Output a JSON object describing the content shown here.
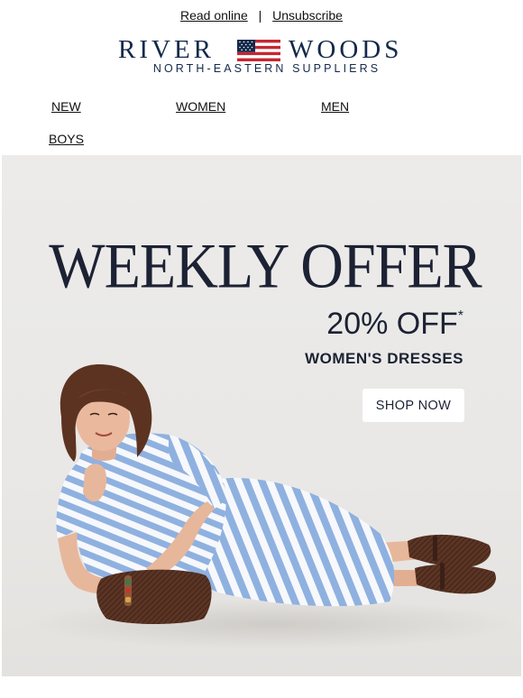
{
  "header": {
    "read_online": "Read online",
    "separator": "|",
    "unsubscribe": "Unsubscribe"
  },
  "brand": {
    "word_left": "RIVER",
    "word_right": "WOODS",
    "tagline": "NORTH-EASTERN SUPPLIERS",
    "color": "#13294b"
  },
  "nav": {
    "items": [
      "NEW",
      "WOMEN",
      "MEN",
      "BOYS"
    ]
  },
  "hero": {
    "headline": "WEEKLY OFFER",
    "offer": "20% OFF",
    "offer_mark": "*",
    "subline": "WOMEN'S DRESSES",
    "cta": "SHOP NOW",
    "text_color": "#1c2233",
    "background": "#ebeae8"
  }
}
